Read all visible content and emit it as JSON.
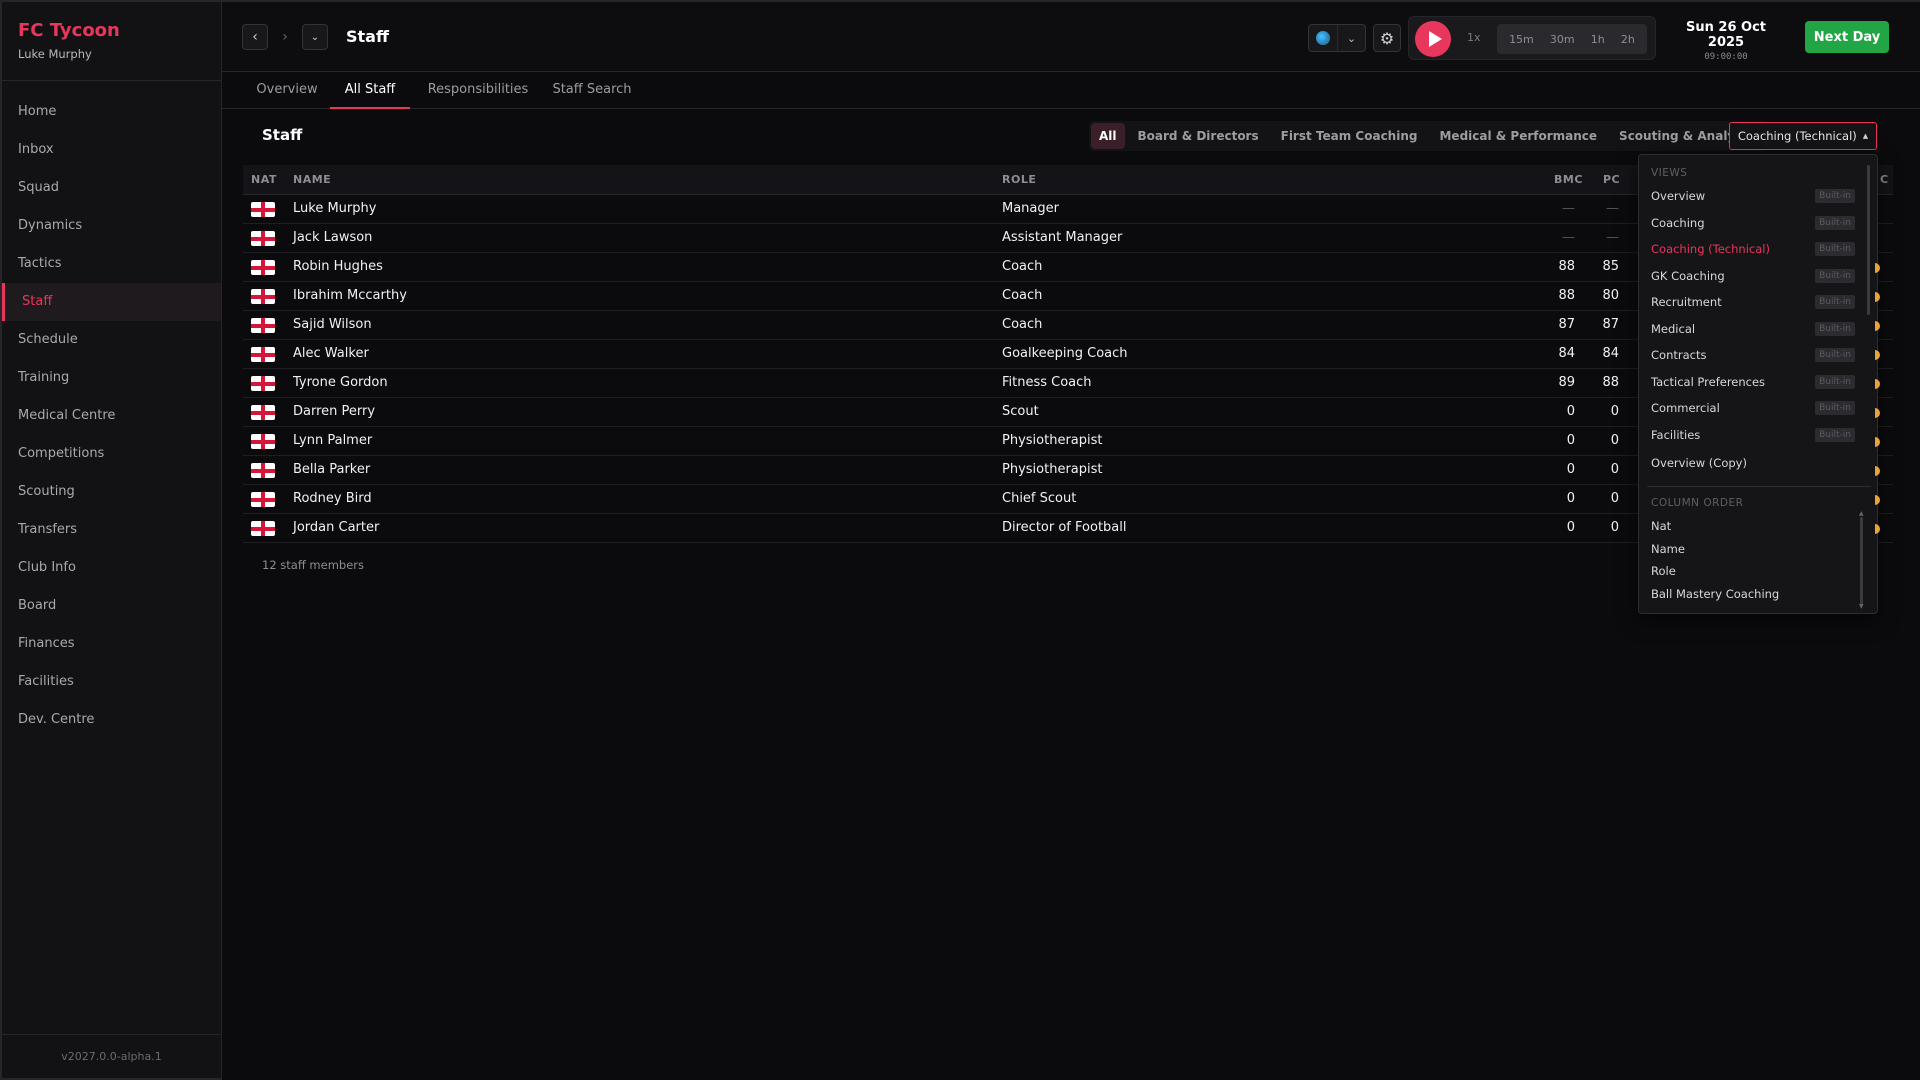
{
  "brand": {
    "title": "FC Tycoon",
    "user": "Luke Murphy"
  },
  "sidebar": {
    "items": [
      {
        "label": "Home"
      },
      {
        "label": "Inbox"
      },
      {
        "label": "Squad"
      },
      {
        "label": "Dynamics"
      },
      {
        "label": "Tactics"
      },
      {
        "label": "Staff",
        "active": true
      },
      {
        "label": "Schedule"
      },
      {
        "label": "Training"
      },
      {
        "label": "Medical Centre"
      },
      {
        "label": "Competitions"
      },
      {
        "label": "Scouting"
      },
      {
        "label": "Transfers"
      },
      {
        "label": "Club Info"
      },
      {
        "label": "Board"
      },
      {
        "label": "Finances"
      },
      {
        "label": "Facilities"
      },
      {
        "label": "Dev. Centre"
      }
    ],
    "version": "v2027.0.0-alpha.1"
  },
  "header": {
    "title": "Staff",
    "speed": {
      "current": "1x",
      "options": [
        "15m",
        "30m",
        "1h",
        "2h"
      ]
    },
    "date": "Sun 26 Oct 2025",
    "time": "09:00:00",
    "next_day": "Next Day"
  },
  "tabs": [
    {
      "label": "Overview"
    },
    {
      "label": "All Staff",
      "active": true
    },
    {
      "label": "Responsibilities"
    },
    {
      "label": "Staff Search"
    }
  ],
  "main": {
    "heading": "Staff",
    "filters": [
      "All",
      "Board & Directors",
      "First Team Coaching",
      "Medical & Performance",
      "Scouting & Analysis"
    ],
    "view_select": "Coaching (Technical)",
    "columns": {
      "nat": "NAT",
      "name": "NAME",
      "role": "ROLE",
      "bmc": "BMC",
      "pc": "PC",
      "clipped": "C"
    },
    "rows": [
      {
        "name": "Luke Murphy",
        "role": "Manager",
        "bmc": "—",
        "pc": "—"
      },
      {
        "name": "Jack Lawson",
        "role": "Assistant Manager",
        "bmc": "—",
        "pc": "—"
      },
      {
        "name": "Robin Hughes",
        "role": "Coach",
        "bmc": "88",
        "pc": "85"
      },
      {
        "name": "Ibrahim Mccarthy",
        "role": "Coach",
        "bmc": "88",
        "pc": "80"
      },
      {
        "name": "Sajid Wilson",
        "role": "Coach",
        "bmc": "87",
        "pc": "87"
      },
      {
        "name": "Alec Walker",
        "role": "Goalkeeping Coach",
        "bmc": "84",
        "pc": "84"
      },
      {
        "name": "Tyrone Gordon",
        "role": "Fitness Coach",
        "bmc": "89",
        "pc": "88"
      },
      {
        "name": "Darren Perry",
        "role": "Scout",
        "bmc": "0",
        "pc": "0"
      },
      {
        "name": "Lynn Palmer",
        "role": "Physiotherapist",
        "bmc": "0",
        "pc": "0"
      },
      {
        "name": "Bella Parker",
        "role": "Physiotherapist",
        "bmc": "0",
        "pc": "0"
      },
      {
        "name": "Rodney Bird",
        "role": "Chief Scout",
        "bmc": "0",
        "pc": "0"
      },
      {
        "name": "Jordan Carter",
        "role": "Director of Football",
        "bmc": "0",
        "pc": "0"
      }
    ],
    "count": "12 staff members"
  },
  "dropdown": {
    "views_label": "VIEWS",
    "views": [
      {
        "label": "Overview",
        "badge": "Built-in"
      },
      {
        "label": "Coaching",
        "badge": "Built-in"
      },
      {
        "label": "Coaching (Technical)",
        "badge": "Built-in",
        "active": true
      },
      {
        "label": "GK Coaching",
        "badge": "Built-in"
      },
      {
        "label": "Recruitment",
        "badge": "Built-in"
      },
      {
        "label": "Medical",
        "badge": "Built-in"
      },
      {
        "label": "Contracts",
        "badge": "Built-in"
      },
      {
        "label": "Tactical Preferences",
        "badge": "Built-in"
      },
      {
        "label": "Commercial",
        "badge": "Built-in"
      },
      {
        "label": "Facilities",
        "badge": "Built-in"
      },
      {
        "label": "Overview (Copy)",
        "badge": ""
      }
    ],
    "column_order_label": "COLUMN ORDER",
    "column_order": [
      "Nat",
      "Name",
      "Role",
      "Ball Mastery Coaching"
    ]
  },
  "colors": {
    "accent": "#e8365d",
    "next_day": "#22a545",
    "background": "#0b0b0d"
  }
}
